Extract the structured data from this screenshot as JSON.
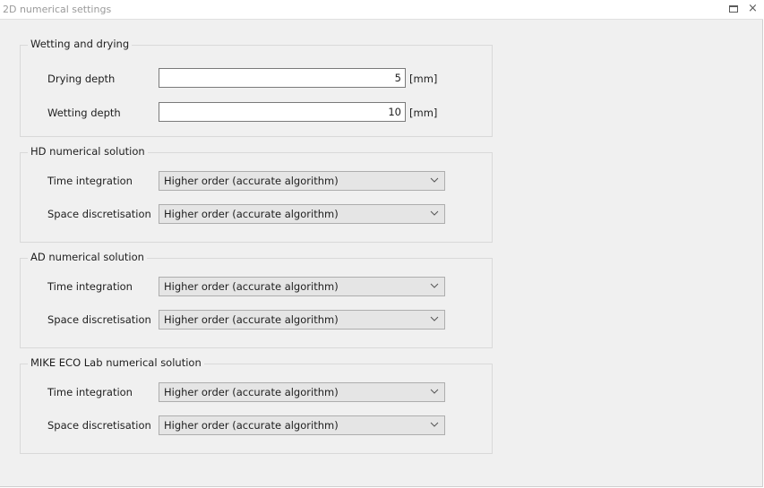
{
  "window": {
    "title": "2D numerical settings",
    "restore_icon": "restore-icon",
    "close_label": "×"
  },
  "wetting": {
    "title": "Wetting and drying",
    "drying": {
      "label": "Drying depth",
      "value": "5",
      "unit": "[mm]"
    },
    "wetting": {
      "label": "Wetting depth",
      "value": "10",
      "unit": "[mm]"
    }
  },
  "hd": {
    "title": "HD numerical solution",
    "time": {
      "label": "Time integration",
      "value": "Higher order (accurate algorithm)"
    },
    "space": {
      "label": "Space discretisation",
      "value": "Higher order (accurate algorithm)"
    }
  },
  "ad": {
    "title": "AD numerical solution",
    "time": {
      "label": "Time integration",
      "value": "Higher order (accurate algorithm)"
    },
    "space": {
      "label": "Space discretisation",
      "value": "Higher order (accurate algorithm)"
    }
  },
  "eco": {
    "title": "MIKE ECO Lab numerical solution",
    "time": {
      "label": "Time integration",
      "value": "Higher order (accurate algorithm)"
    },
    "space": {
      "label": "Space discretisation",
      "value": "Higher order (accurate algorithm)"
    }
  }
}
